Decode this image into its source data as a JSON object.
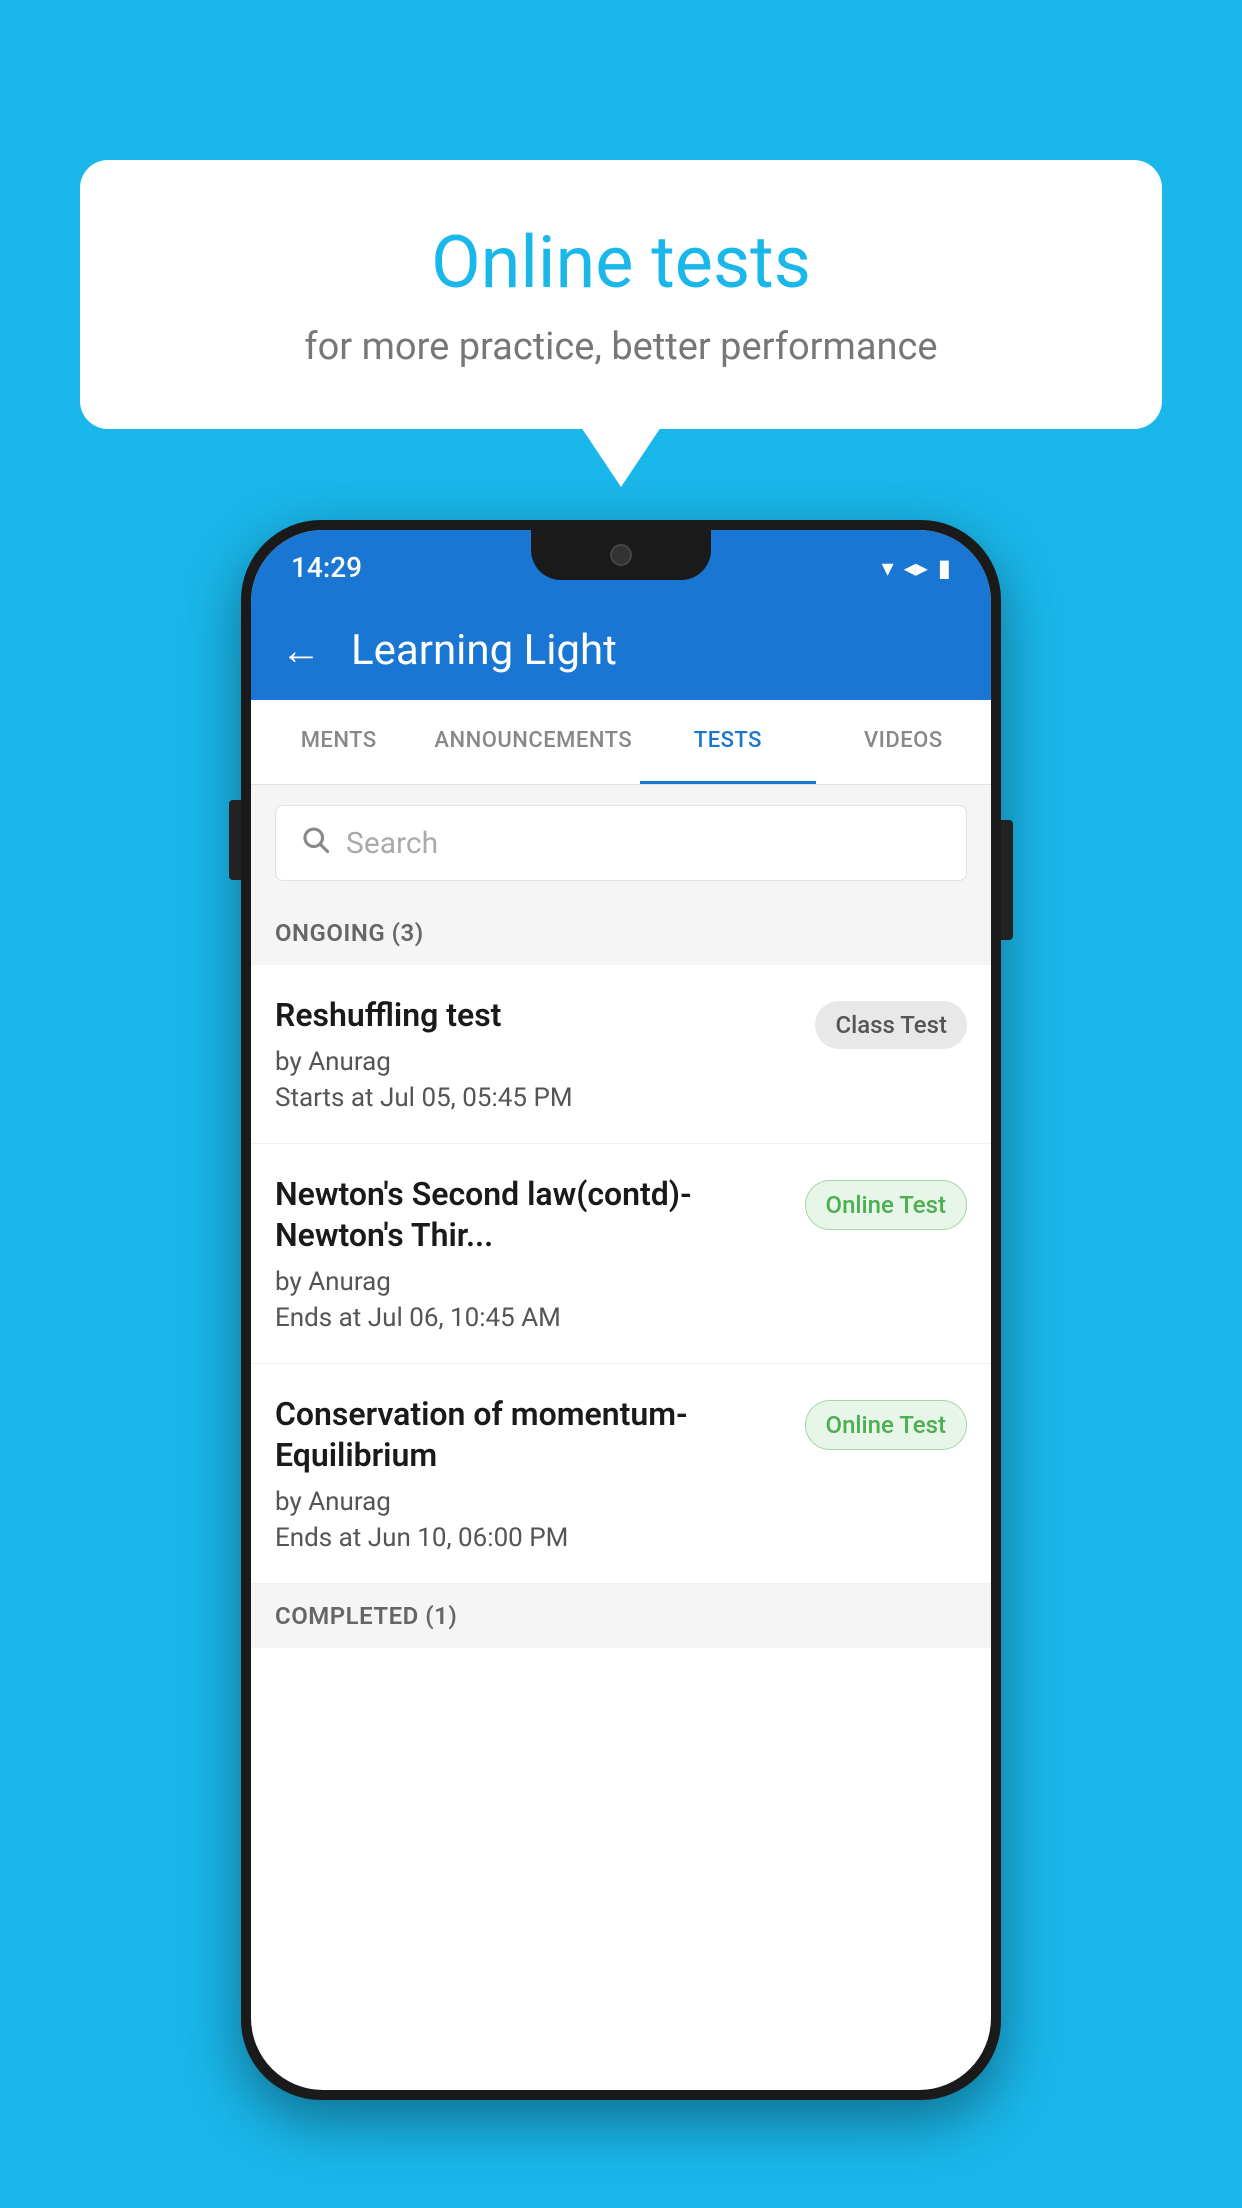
{
  "background": {
    "color": "#1ab7ea"
  },
  "speech_bubble": {
    "title": "Online tests",
    "subtitle": "for more practice, better performance"
  },
  "phone": {
    "status_bar": {
      "time": "14:29",
      "wifi": "▼",
      "signal": "▲",
      "battery": "▮"
    },
    "header": {
      "back_label": "←",
      "title": "Learning Light"
    },
    "tabs": [
      {
        "label": "MENTS",
        "active": false
      },
      {
        "label": "ANNOUNCEMENTS",
        "active": false
      },
      {
        "label": "TESTS",
        "active": true
      },
      {
        "label": "VIDEOS",
        "active": false
      }
    ],
    "search": {
      "placeholder": "Search"
    },
    "sections": [
      {
        "header": "ONGOING (3)",
        "items": [
          {
            "name": "Reshuffling test",
            "author": "by Anurag",
            "time": "Starts at  Jul 05, 05:45 PM",
            "badge": "Class Test",
            "badge_type": "class"
          },
          {
            "name": "Newton's Second law(contd)-Newton's Thir...",
            "author": "by Anurag",
            "time": "Ends at  Jul 06, 10:45 AM",
            "badge": "Online Test",
            "badge_type": "online"
          },
          {
            "name": "Conservation of momentum-Equilibrium",
            "author": "by Anurag",
            "time": "Ends at  Jun 10, 06:00 PM",
            "badge": "Online Test",
            "badge_type": "online"
          }
        ]
      },
      {
        "header": "COMPLETED (1)",
        "items": []
      }
    ]
  }
}
